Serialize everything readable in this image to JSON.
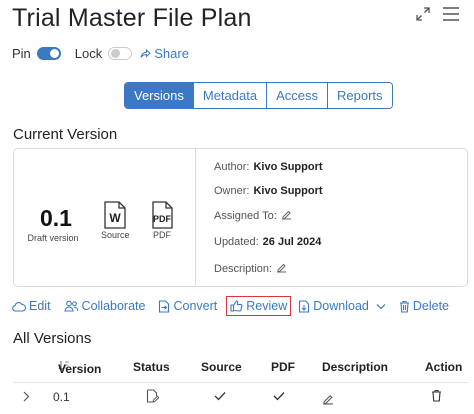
{
  "header": {
    "title": "Trial Master File Plan",
    "expand_icon": "expand-arrows-icon",
    "menu_icon": "hamburger-menu-icon"
  },
  "toggles": {
    "pin_label": "Pin",
    "pin_on": true,
    "lock_label": "Lock",
    "lock_on": false,
    "share_label": "Share"
  },
  "tabs": [
    {
      "label": "Versions",
      "active": true
    },
    {
      "label": "Metadata",
      "active": false
    },
    {
      "label": "Access",
      "active": false
    },
    {
      "label": "Reports",
      "active": false
    }
  ],
  "current_version": {
    "section_title": "Current Version",
    "version": "0.1",
    "version_label": "Draft version",
    "source_label": "Source",
    "pdf_label": "PDF",
    "author_label": "Author:",
    "author": "Kivo Support",
    "owner_label": "Owner:",
    "owner": "Kivo Support",
    "assigned_label": "Assigned To:",
    "updated_label": "Updated:",
    "updated": "26 Jul 2024",
    "description_label": "Description:"
  },
  "actions": {
    "edit": "Edit",
    "collaborate": "Collaborate",
    "convert": "Convert",
    "review": "Review",
    "download": "Download",
    "delete": "Delete"
  },
  "all_versions": {
    "section_title": "All Versions",
    "columns": [
      "Version",
      "Status",
      "Source",
      "PDF",
      "Description",
      "Action"
    ],
    "rows": [
      {
        "version": "0.1"
      }
    ]
  },
  "colors": {
    "accent": "#3b79c4",
    "highlight": "#d9363e"
  }
}
